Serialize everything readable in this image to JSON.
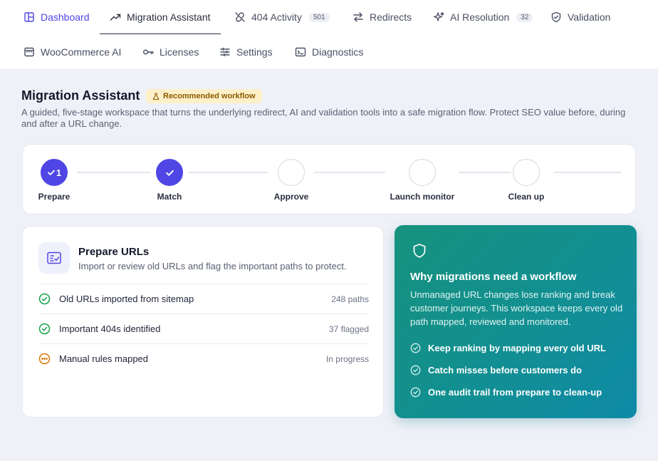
{
  "nav": {
    "tabs": [
      {
        "label": "Dashboard",
        "icon": "dashboard-icon"
      },
      {
        "label": "Migration Assistant",
        "icon": "trend-up-icon"
      },
      {
        "label": "404 Activity",
        "icon": "broken-link-icon",
        "count": "501"
      },
      {
        "label": "Redirects",
        "icon": "arrows-swap-icon"
      },
      {
        "label": "AI Resolution",
        "icon": "sparkle-icon",
        "count": "32"
      },
      {
        "label": "Validation",
        "icon": "shield-check-icon"
      },
      {
        "label": "WooCommerce AI",
        "icon": "store-icon"
      },
      {
        "label": "Licenses",
        "icon": "key-icon"
      },
      {
        "label": "Settings",
        "icon": "sliders-icon"
      },
      {
        "label": "Diagnostics",
        "icon": "terminal-icon"
      }
    ]
  },
  "header": {
    "title": "Migration Assistant",
    "badge": "Recommended workflow",
    "subtitle": "A guided, five-stage workspace that turns the underlying redirect, AI and validation tools into a safe migration flow. Protect SEO value before, during and after a URL change."
  },
  "stepper": {
    "steps": [
      {
        "label": "Prepare",
        "state": "done",
        "number": "1"
      },
      {
        "label": "Match",
        "state": "done"
      },
      {
        "label": "Approve",
        "state": "pending"
      },
      {
        "label": "Launch monitor",
        "state": "pending"
      },
      {
        "label": "Clean up",
        "state": "pending"
      }
    ]
  },
  "prepare": {
    "title": "Prepare URLs",
    "description": "Import or review old URLs and flag the important paths to protect.",
    "tasks": [
      {
        "label": "Old URLs imported from sitemap",
        "meta": "248 paths",
        "status": "done"
      },
      {
        "label": "Important 404s identified",
        "meta": "37 flagged",
        "status": "done"
      },
      {
        "label": "Manual rules mapped",
        "meta": "In progress",
        "status": "in-progress"
      }
    ]
  },
  "info": {
    "title": "Why migrations need a workflow",
    "description": "Unmanaged URL changes lose ranking and break customer journeys. This workspace keeps every old path mapped, reviewed and monitored.",
    "bullets": [
      "Keep ranking by mapping every old URL",
      "Catch misses before customers do",
      "One audit trail from prepare to clean-up"
    ]
  },
  "colors": {
    "accent": "#4f46e5",
    "success": "#16a34a",
    "warning": "#d97706",
    "badge_bg": "#fdf0c9",
    "teal": "#128f92"
  }
}
